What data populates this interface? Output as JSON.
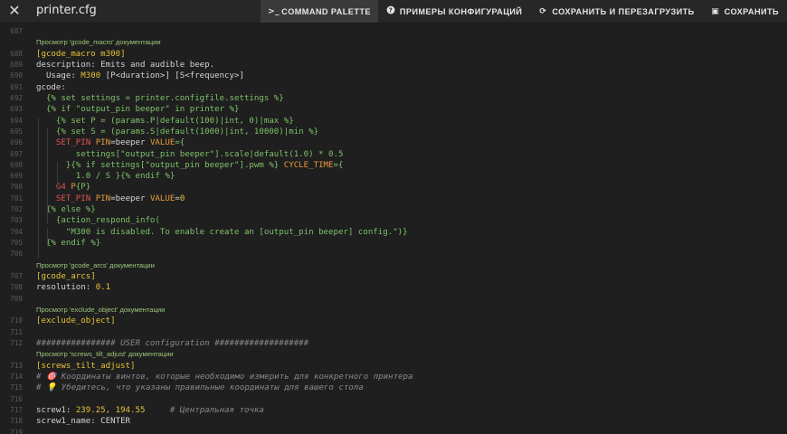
{
  "window": {
    "close_icon": "close-icon",
    "file_name": "printer.cfg"
  },
  "toolbar": {
    "command_palette": {
      "icon": ">_",
      "label": "COMMAND PALETTE"
    },
    "examples": {
      "icon": "?",
      "label": "ПРИМЕРЫ КОНФИГУРАЦИЙ"
    },
    "save_restart": {
      "icon": "⟳",
      "label": "СОХРАНИТЬ И ПЕРЕЗАГРУЗИТЬ"
    },
    "save": {
      "icon": "▣",
      "label": "СОХРАНИТЬ"
    }
  },
  "colors": {
    "background": "#1f1f1f",
    "toolbar_bg": "#272727",
    "section_yellow": "#e6c33a",
    "template_green": "#7ec26a",
    "keyword_orange": "#e89a3c",
    "gcode_red": "#e05252",
    "comment_gray": "#8a8a8a",
    "doc_link_green": "#9ac77a"
  },
  "editor": {
    "lines": [
      {
        "kind": "code",
        "num": "687",
        "segs": []
      },
      {
        "kind": "doc",
        "text": "Просмотр 'gcode_macro' документации"
      },
      {
        "kind": "code",
        "num": "688",
        "segs": [
          [
            "y",
            "[gcode_macro m300]"
          ]
        ]
      },
      {
        "kind": "code",
        "num": "689",
        "segs": [
          [
            "w",
            "description: Emits and audible beep."
          ]
        ]
      },
      {
        "kind": "code",
        "num": "690",
        "segs": [
          [
            "w",
            "  Usage: "
          ],
          [
            "y",
            "M300"
          ],
          [
            "w",
            " [P<duration>] [S<frequency>]"
          ]
        ]
      },
      {
        "kind": "code",
        "num": "691",
        "segs": [
          [
            "w",
            "gcode:"
          ]
        ]
      },
      {
        "kind": "code",
        "num": "692",
        "segs": [
          [
            "g",
            "  {% set settings = printer.configfile.settings %}"
          ]
        ]
      },
      {
        "kind": "code",
        "num": "693",
        "segs": [
          [
            "g",
            "  {% if \"output_pin beeper\" in printer %}"
          ]
        ]
      },
      {
        "kind": "code",
        "num": "694",
        "segs": [
          [
            "g",
            "    {% set P = (params.P|default(100)|int, 0)|max %}"
          ]
        ]
      },
      {
        "kind": "code",
        "num": "695",
        "segs": [
          [
            "g",
            "    {% set S = (params.S|default(1000)|int, 10000)|min %}"
          ]
        ]
      },
      {
        "kind": "code",
        "num": "696",
        "segs": [
          [
            "r",
            "    SET_PIN"
          ],
          [
            "o",
            " PIN"
          ],
          [
            "w",
            "=beeper"
          ],
          [
            "o",
            " VALUE"
          ],
          [
            "g",
            "={"
          ]
        ]
      },
      {
        "kind": "code",
        "num": "697",
        "segs": [
          [
            "g",
            "        settings[\"output_pin beeper\"].scale|default(1.0) * 0.5"
          ]
        ]
      },
      {
        "kind": "code",
        "num": "698",
        "segs": [
          [
            "g",
            "      }{% if settings[\"output_pin beeper\"].pwm %}"
          ],
          [
            "o",
            " CYCLE_TIME"
          ],
          [
            "g",
            "={"
          ]
        ]
      },
      {
        "kind": "code",
        "num": "699",
        "segs": [
          [
            "g",
            "        1.0 / S }{% endif %}"
          ]
        ]
      },
      {
        "kind": "code",
        "num": "700",
        "segs": [
          [
            "r",
            "    G4"
          ],
          [
            "o",
            " P"
          ],
          [
            "g",
            "{P}"
          ]
        ]
      },
      {
        "kind": "code",
        "num": "701",
        "segs": [
          [
            "r",
            "    SET_PIN"
          ],
          [
            "o",
            " PIN"
          ],
          [
            "w",
            "=beeper"
          ],
          [
            "o",
            " VALUE"
          ],
          [
            "w",
            "="
          ],
          [
            "y",
            "0"
          ]
        ]
      },
      {
        "kind": "code",
        "num": "702",
        "segs": [
          [
            "g",
            "  {% else %}"
          ]
        ]
      },
      {
        "kind": "code",
        "num": "703",
        "segs": [
          [
            "g",
            "    {action_respond_info("
          ]
        ]
      },
      {
        "kind": "code",
        "num": "704",
        "segs": [
          [
            "g",
            "      \"M300 is disabled. To enable create an [output_pin beeper] config.\")}"
          ]
        ]
      },
      {
        "kind": "code",
        "num": "705",
        "segs": [
          [
            "g",
            "  {% endif %}"
          ]
        ]
      },
      {
        "kind": "code",
        "num": "706",
        "segs": []
      },
      {
        "kind": "doc",
        "text": "Просмотр 'gcode_arcs' документации"
      },
      {
        "kind": "code",
        "num": "707",
        "segs": [
          [
            "y",
            "[gcode_arcs]"
          ]
        ]
      },
      {
        "kind": "code",
        "num": "708",
        "segs": [
          [
            "w",
            "resolution: "
          ],
          [
            "y",
            "0.1"
          ]
        ]
      },
      {
        "kind": "code",
        "num": "709",
        "segs": []
      },
      {
        "kind": "doc",
        "text": "Просмотр 'exclude_object' документации"
      },
      {
        "kind": "code",
        "num": "710",
        "segs": [
          [
            "y",
            "[exclude_object]"
          ]
        ]
      },
      {
        "kind": "code",
        "num": "711",
        "segs": []
      },
      {
        "kind": "code",
        "num": "712",
        "segs": [
          [
            "c",
            "################ USER configuration ###################"
          ]
        ]
      },
      {
        "kind": "doc",
        "text": "Просмотр 'screws_tilt_adjust' документации"
      },
      {
        "kind": "code",
        "num": "713",
        "segs": [
          [
            "y",
            "[screws_tilt_adjust]"
          ]
        ]
      },
      {
        "kind": "code",
        "num": "714",
        "segs": [
          [
            "c",
            "# 🎯 Координаты винтов, которые необходимо измерить для конкретного принтера"
          ]
        ]
      },
      {
        "kind": "code",
        "num": "715",
        "segs": [
          [
            "c",
            "# 💡 Убедитесь, что указаны правильные координаты для вашего стола"
          ]
        ]
      },
      {
        "kind": "code",
        "num": "716",
        "segs": []
      },
      {
        "kind": "code",
        "num": "717",
        "segs": [
          [
            "w",
            "screw1: "
          ],
          [
            "y",
            "239.25, 194.55"
          ],
          [
            "c",
            "     # Центральная точка"
          ]
        ]
      },
      {
        "kind": "code",
        "num": "718",
        "segs": [
          [
            "w",
            "screw1_name: CENTER"
          ]
        ]
      },
      {
        "kind": "code",
        "num": "719",
        "segs": []
      }
    ]
  }
}
